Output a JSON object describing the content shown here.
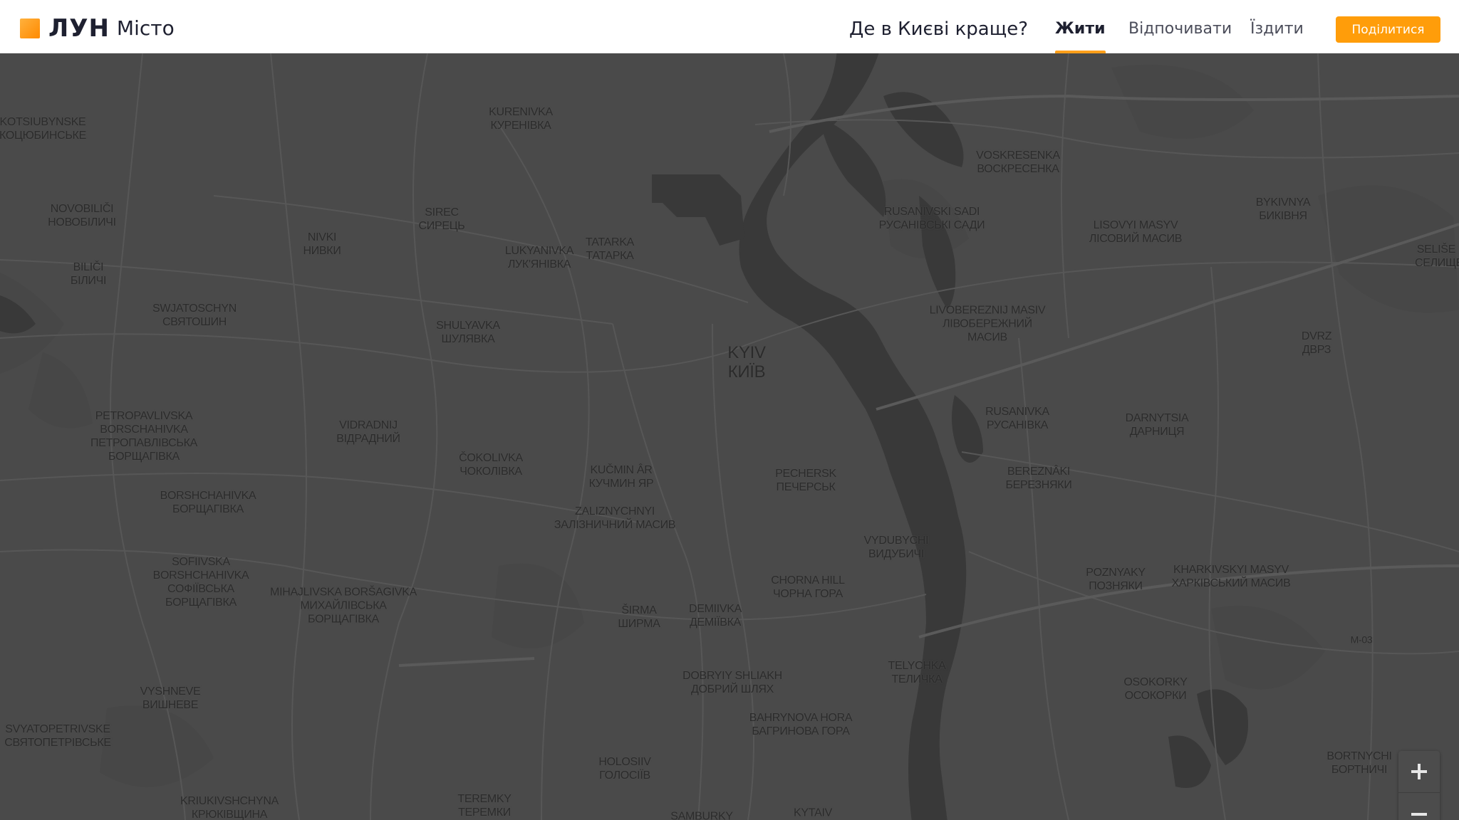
{
  "header": {
    "logo_brand": "ЛУН",
    "logo_sub": "Місто",
    "question": "Де в Києві краще?",
    "tabs": [
      {
        "label": "Жити",
        "active": true
      },
      {
        "label": "Відпочивати",
        "active": false
      },
      {
        "label": "Їздити",
        "active": false
      }
    ],
    "share_label": "Поділитися",
    "accent_color": "#ff9d0a"
  },
  "map": {
    "city_label": "KYIV\nКИЇВ",
    "labels": [
      "KOTSIUBYNSKE\nКОЦЮБИНСЬКЕ",
      "KURENIVKA\nКУРЕНІВКА",
      "VOSKRESENKA\nВОСКРЕСЕНКА",
      "BYKIVNYA\nБИКІВНЯ",
      "NOVOBILIČI\nНОВОБІЛИЧІ",
      "SIREC\nСИРЕЦЬ",
      "NIVKI\nНИВКИ",
      "TATARKA\nТАТАРКА",
      "LUKYANIVKA\nЛУК'ЯНІВКА",
      "RUSANIVSKI SADI\nРУСАНІВСЬКІ САДИ",
      "LISOVYI MASYV\nЛІСОВИЙ МАСИВ",
      "SELIŠE I\nСЕЛИЩЕ",
      "BILIČI\nБІЛИЧІ",
      "SWJATOSCHYN\nСВЯТОШИН",
      "SHULYAVKA\nШУЛЯВКА",
      "LIVOBEREZNIJ MASIV\nЛІВОБЕРЕЖНИЙ\nМАСИВ",
      "DVRZ\nДВРЗ",
      "PETROPAVLIVSKA\nBORSCHAHIVKA\nПЕТРОПАВЛІВСЬКА\nБОРЩАГІВКА",
      "VIDRADNIJ\nВІДРАДНИЙ",
      "RUSANIVKA\nРУСАНІВКА",
      "DARNYTSIA\nДАРНИЦЯ",
      "ČOKOLIVKA\nЧОКОЛІВКА",
      "KUČMIN ÂR\nКУЧМИН ЯР",
      "PECHERSK\nПЕЧЕРСЬК",
      "BEREZNÂKI\nБЕРЕЗНЯКИ",
      "BORSHCHAHIVKA\nБОРЩАГІВКА",
      "ZALIZNYCHNYI\nЗАЛІЗНИЧНИЙ МАСИВ",
      "VYDUBYCHI\nВИДУБИЧІ",
      "SOFIIVSKA\nBORSHCHAHIVKA\nСОФІЇВСЬКА\nБОРЩАГІВКА",
      "MIHAJLIVSKA BORŠAGIVKA\nМИХАЙЛІВСЬКА\nБОРЩАГІВКА",
      "POZNYAKY\nПОЗНЯКИ",
      "KHARKIVSKYI MASYV\nХАРКІВСЬКИЙ МАСИВ",
      "CHORNA HILL\nЧОРНА ГОРА",
      "ŠIRMA\nШИРМА",
      "DEMIIVKA\nДЕМІЇВКА",
      "TELYCHKA\nТЕЛИЧКА",
      "DOBRYIY SHLIAKH\nДОБРИЙ ШЛЯХ",
      "OSOKORKY\nОСОКОРКИ",
      "VYSHNEVE\nВИШНЕВЕ",
      "BAHRYNOVA HORA\nБАГРИНОВА ГОРА",
      "SVYATOPETRIVSKE\nСВЯТОПЕТРІВСЬКЕ",
      "HOLOSIIV\nГОЛОСІЇВ",
      "BORTNYCHI\nБОРТНИЧІ",
      "KRIUKIVSHCHYNA\nКРЮКІВЩИНА",
      "TEREMKY\nТЕРЕМКИ",
      "SAMBURKY",
      "KYTAIV"
    ],
    "road_label": "M-03",
    "colors": {
      "land": "#4a4a4a",
      "water": "#393939",
      "roads": "#565656",
      "label": "#2b2b2b"
    },
    "zoom_in_icon": "plus-icon",
    "zoom_out_icon": "minus-icon"
  }
}
